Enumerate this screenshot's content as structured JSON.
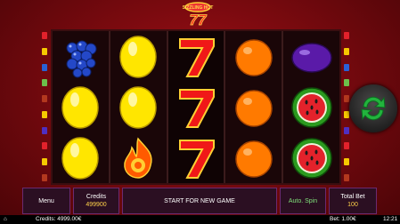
{
  "game": {
    "logo_text": "SIZZLING HOT",
    "logo_number": "77",
    "reels": [
      [
        "grapes",
        "lemon",
        "lemon"
      ],
      [
        "lemon",
        "lemon",
        "star-flame"
      ],
      [
        "seven",
        "seven",
        "seven"
      ],
      [
        "orange",
        "orange",
        "orange"
      ],
      [
        "plum",
        "watermelon",
        "watermelon"
      ]
    ],
    "colors": {
      "accent": "#ffd24a",
      "panel_border": "#6b2a70",
      "spin_green": "#22b43d"
    }
  },
  "controls": {
    "menu_label": "Menu",
    "credits_label": "Credits",
    "credits_value": "499900",
    "start_label": "START FOR NEW GAME",
    "auto_spin_label": "Auto. Spin",
    "total_bet_label": "Total Bet",
    "total_bet_value": "100"
  },
  "status": {
    "credits": "Credits: 4999.00€",
    "bet": "Bet: 1.00€",
    "time": "12:21"
  }
}
